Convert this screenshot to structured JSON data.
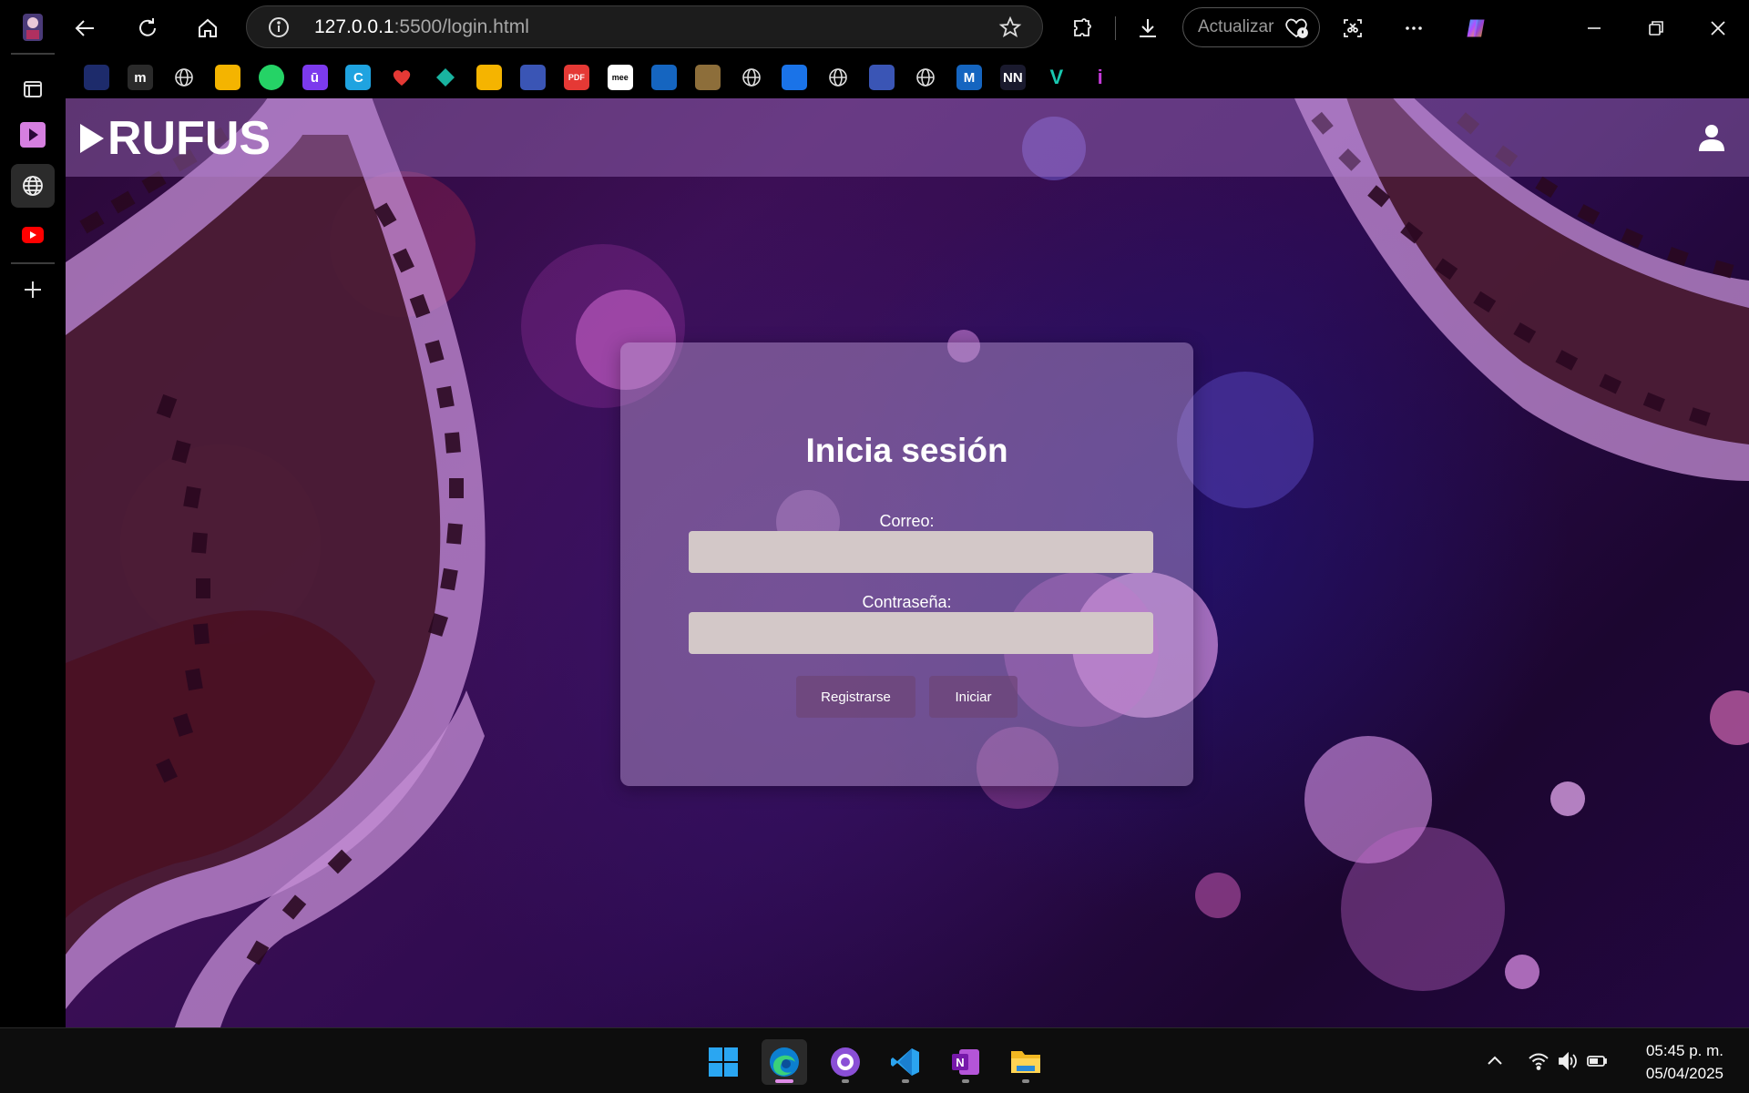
{
  "browser": {
    "url_host": "127.0.0.1",
    "url_rest": ":5500/login.html",
    "update_label": "Actualizar"
  },
  "favorites": [
    {
      "name": "fav-shield",
      "text": "",
      "bg": "#1d2b6b"
    },
    {
      "name": "fav-m",
      "text": "m",
      "bg": "#2a2a2a"
    },
    {
      "name": "fav-globe-1",
      "text": "",
      "bg": "transparent"
    },
    {
      "name": "fav-classroom",
      "text": "",
      "bg": "#f4b400"
    },
    {
      "name": "fav-whatsapp",
      "text": "",
      "bg": "#25d366"
    },
    {
      "name": "fav-u",
      "text": "ū",
      "bg": "#7c3aed"
    },
    {
      "name": "fav-canva",
      "text": "C",
      "bg": "#1fa3e0"
    },
    {
      "name": "fav-heart",
      "text": "",
      "bg": "transparent"
    },
    {
      "name": "fav-diamond",
      "text": "",
      "bg": "transparent"
    },
    {
      "name": "fav-book",
      "text": "",
      "bg": "#f5b400"
    },
    {
      "name": "fav-wizard-1",
      "text": "",
      "bg": "#3a55b5"
    },
    {
      "name": "fav-pdf",
      "text": "PDF",
      "bg": "#e53935"
    },
    {
      "name": "fav-mee",
      "text": "mee",
      "bg": "#ffffff"
    },
    {
      "name": "fav-blue-circle",
      "text": "",
      "bg": "#1565c0"
    },
    {
      "name": "fav-crest",
      "text": "",
      "bg": "#8d6e3a"
    },
    {
      "name": "fav-grid",
      "text": "",
      "bg": "transparent"
    },
    {
      "name": "fav-docs",
      "text": "",
      "bg": "#1a73e8"
    },
    {
      "name": "fav-globe-2",
      "text": "",
      "bg": "transparent"
    },
    {
      "name": "fav-wizard-2",
      "text": "",
      "bg": "#3a55b5"
    },
    {
      "name": "fav-github",
      "text": "",
      "bg": "transparent"
    },
    {
      "name": "fav-m-blue",
      "text": "M",
      "bg": "#1565c0"
    },
    {
      "name": "fav-nn",
      "text": "NN",
      "bg": "#1a1a2e"
    },
    {
      "name": "fav-v",
      "text": "V",
      "bg": "transparent"
    },
    {
      "name": "fav-i",
      "text": "i",
      "bg": "transparent"
    }
  ],
  "page": {
    "brand": "RUFUS",
    "login_title": "Inicia sesión",
    "email_label": "Correo:",
    "email_value": "",
    "password_label": "Contraseña:",
    "password_value": "",
    "register_label": "Registrarse",
    "login_label": "Iniciar"
  },
  "taskbar": {
    "time": "05:45 p. m.",
    "date": "05/04/2025"
  },
  "colors": {
    "header_overlay": "#b482d2",
    "card_bg": "#bea0d2",
    "input_bg": "#d3c8c8",
    "button_bg": "#6e4678"
  }
}
